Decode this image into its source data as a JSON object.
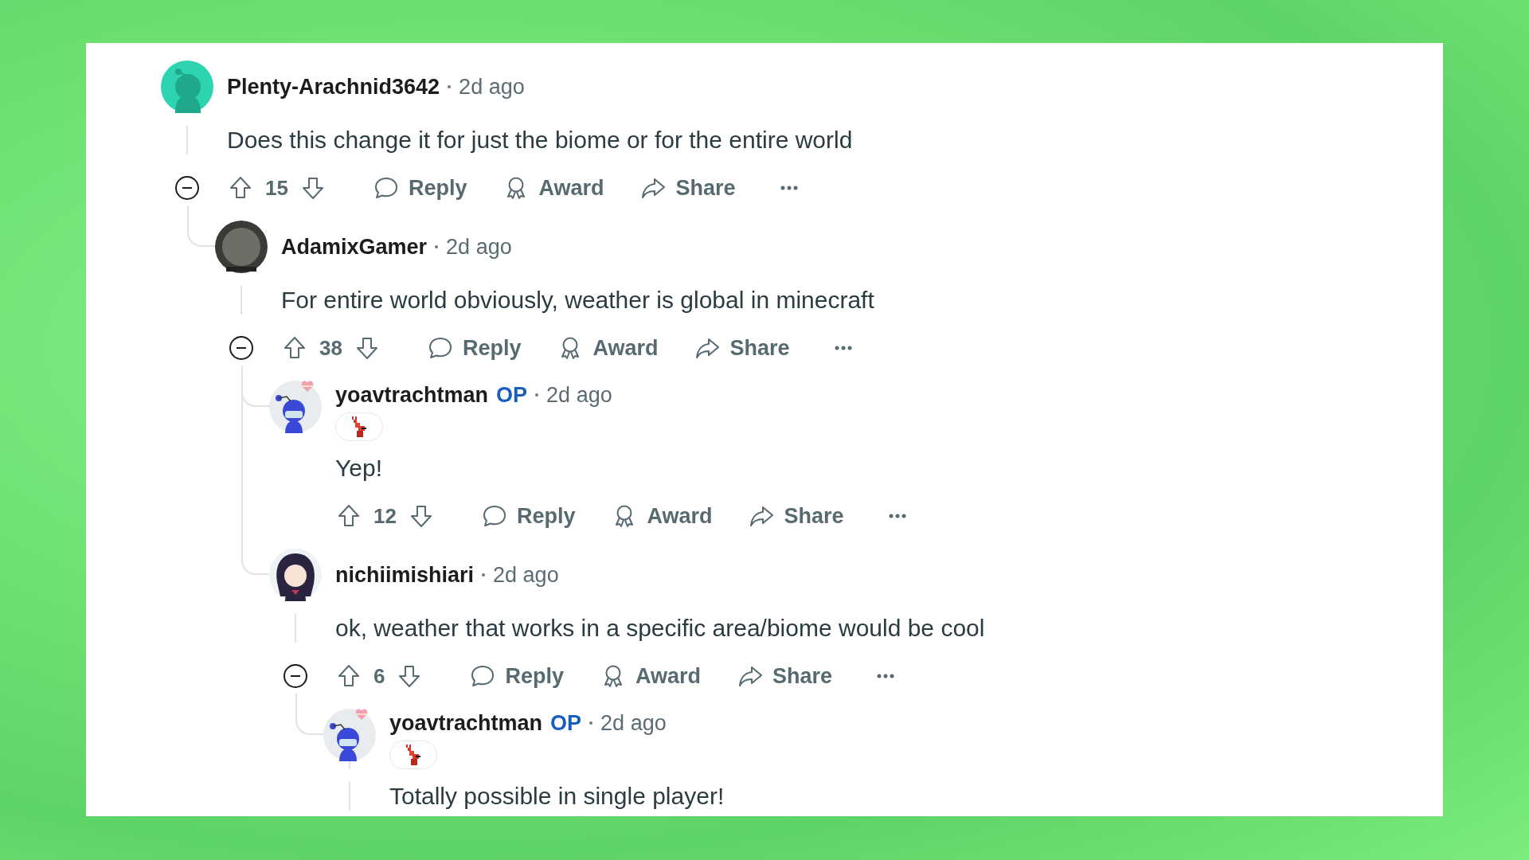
{
  "comments": [
    {
      "author": "Plenty-Arachnid3642",
      "avatar": {
        "kind": "snoo-teal"
      },
      "time": "2d ago",
      "flair": false,
      "text": "Does this change it for just the biome or for the entire world",
      "votes": "15",
      "collapsible": true,
      "actions": [
        "Reply",
        "Award",
        "Share"
      ],
      "children": [
        {
          "author": "AdamixGamer",
          "avatar": {
            "kind": "photo"
          },
          "time": "2d ago",
          "flair": false,
          "text": "For entire world obviously, weather is global in minecraft",
          "votes": "38",
          "collapsible": true,
          "actions": [
            "Reply",
            "Award",
            "Share"
          ],
          "children": [
            {
              "author": "yoavtrachtman",
              "avatar": {
                "kind": "snoo-blue"
              },
              "op_label": "OP",
              "time": "2d ago",
              "flair": true,
              "text": "Yep!",
              "votes": "12",
              "collapsible": false,
              "actions": [
                "Reply",
                "Award",
                "Share"
              ],
              "more_replies": false
            },
            {
              "author": "nichiimishiari",
              "avatar": {
                "kind": "drawing"
              },
              "time": "2d ago",
              "flair": false,
              "text": "ok, weather that works in a specific area/biome would be cool",
              "votes": "6",
              "collapsible": true,
              "actions": [
                "Reply",
                "Award",
                "Share"
              ],
              "children": [
                {
                  "author": "yoavtrachtman",
                  "avatar": {
                    "kind": "snoo-blue"
                  },
                  "op_label": "OP",
                  "time": "2d ago",
                  "flair": true,
                  "text": "Totally possible in single player!",
                  "more_replies": true
                }
              ]
            }
          ]
        }
      ]
    }
  ]
}
